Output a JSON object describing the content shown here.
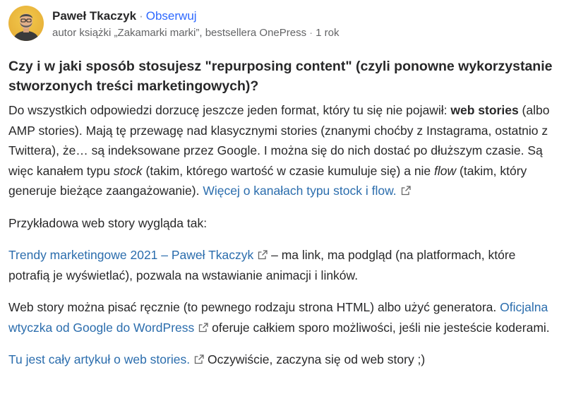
{
  "author": {
    "name": "Paweł Tkaczyk",
    "separator": "·",
    "follow_label": "Obserwuj",
    "bio": "autor książki „Zakamarki marki”, bestsellera OnePress",
    "time": "1 rok"
  },
  "question": "Czy i w jaki sposób stosujesz \"repurposing content\" (czyli ponowne wykorzystanie stworzonych treści marketingowych)?",
  "answer": {
    "p1": {
      "t1": "Do wszystkich odpowiedzi dorzucę jeszcze jeden format, który tu się nie pojawił: ",
      "b1": "web stories",
      "t2": " (albo AMP stories). Mają tę przewagę nad klasycznymi stories (znanymi choćby z Instagrama, ostatnio z Twittera), że… są indeksowane przez Google. I można się do nich dostać po dłuższym czasie. Są więc kanałem typu ",
      "i1": "stock",
      "t3": " (takim, którego wartość w czasie kumuluje się) a nie ",
      "i2": "flow",
      "t4": " (takim, który generuje bieżące zaangażowanie). ",
      "link": "Więcej o kanałach typu stock i flow."
    },
    "p2": "Przykładowa web story wygląda tak:",
    "p3": {
      "link": "Trendy marketingowe 2021 – Paweł Tkaczyk",
      "text": " – ma link, ma podgląd (na platformach, które potrafią je wyświetlać), pozwala na wstawianie animacji i linków."
    },
    "p4": {
      "t1": "Web story można pisać ręcznie (to pewnego rodzaju strona HTML) albo użyć generatora. ",
      "link": "Oficjalna wtyczka od Google do WordPress",
      "t2": " oferuje całkiem sporo możliwości, jeśli nie jesteście koderami."
    },
    "p5": {
      "link": "Tu jest cały artykuł o web stories.",
      "text": " Oczywiście, zaczyna się od web story ;)"
    }
  },
  "colors": {
    "link": "#2b6dad",
    "follow": "#2e69ff",
    "text": "#282829",
    "muted": "#636466",
    "avatar_bg": "#f2c94c"
  },
  "icons": {
    "external_link": "external-link-icon"
  }
}
